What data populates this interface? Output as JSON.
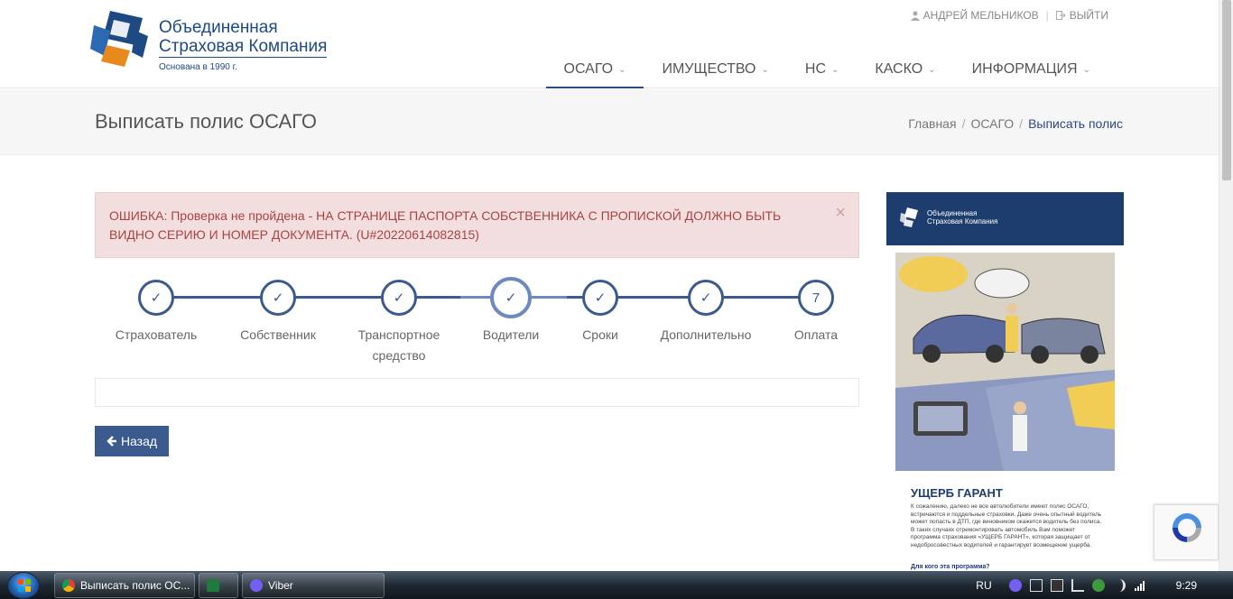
{
  "logo": {
    "line1": "Объединенная",
    "line2": "Страховая Компания",
    "founded": "Основана в 1990 г."
  },
  "userbar": {
    "user_name": "АНДРЕЙ МЕЛЬНИКОВ",
    "logout": "ВЫЙТИ"
  },
  "nav": [
    {
      "label": "ОСАГО",
      "active": true
    },
    {
      "label": "ИМУЩЕСТВО"
    },
    {
      "label": "НС"
    },
    {
      "label": "КАСКО"
    },
    {
      "label": "ИНФОРМАЦИЯ"
    }
  ],
  "page_title": "Выписать полис ОСАГО",
  "breadcrumb": {
    "home": "Главная",
    "section": "ОСАГО",
    "current": "Выписать полис"
  },
  "alert": {
    "text": "ОШИБКА: Проверка не пройдена - НА СТРАНИЦЕ ПАСПОРТА СОБСТВЕННИКА С ПРОПИСКОЙ ДОЛЖНО БЫТЬ ВИДНО СЕРИЮ И НОМЕР ДОКУМЕНТА. (U#20220614082815)",
    "close": "×"
  },
  "steps": [
    {
      "label": "Страхователь",
      "mark": "✓"
    },
    {
      "label": "Собственник",
      "mark": "✓"
    },
    {
      "label": "Транспортное средство",
      "mark": "✓"
    },
    {
      "label": "Водители",
      "mark": "✓",
      "current": true
    },
    {
      "label": "Сроки",
      "mark": "✓"
    },
    {
      "label": "Дополнительно",
      "mark": "✓"
    },
    {
      "label": "Оплата",
      "mark": "7"
    }
  ],
  "back_button": "Назад",
  "ad": {
    "logo_line1": "Объединенная",
    "logo_line2": "Страховая Компания",
    "title": "УЩЕРБ ГАРАНТ",
    "text": "К сожалению, далеко не все автолюбители имеют полис ОСАГО, встречаются и поддельные страховки. Даже очень опытный водитель может попасть в ДТП, где виновником окажется водитель без полиса. В таких случаях отремонтировать автомобиль Вам поможет программа страхования «УЩЕРБ ГАРАНТ», которая защищает от недобросовестных водителей и гарантирует возмещение ущерба.",
    "link": "Для кого эта программа?"
  },
  "taskbar": {
    "items": [
      "Выписать полис ОС...",
      "Viber"
    ],
    "lang": "RU",
    "time": "9:29"
  },
  "colors": {
    "brand_blue": "#3b5a8d",
    "brand_dark": "#1d3d6e",
    "accent_orange": "#e8891c",
    "alert_bg": "#f2dede",
    "alert_text": "#a94442"
  }
}
